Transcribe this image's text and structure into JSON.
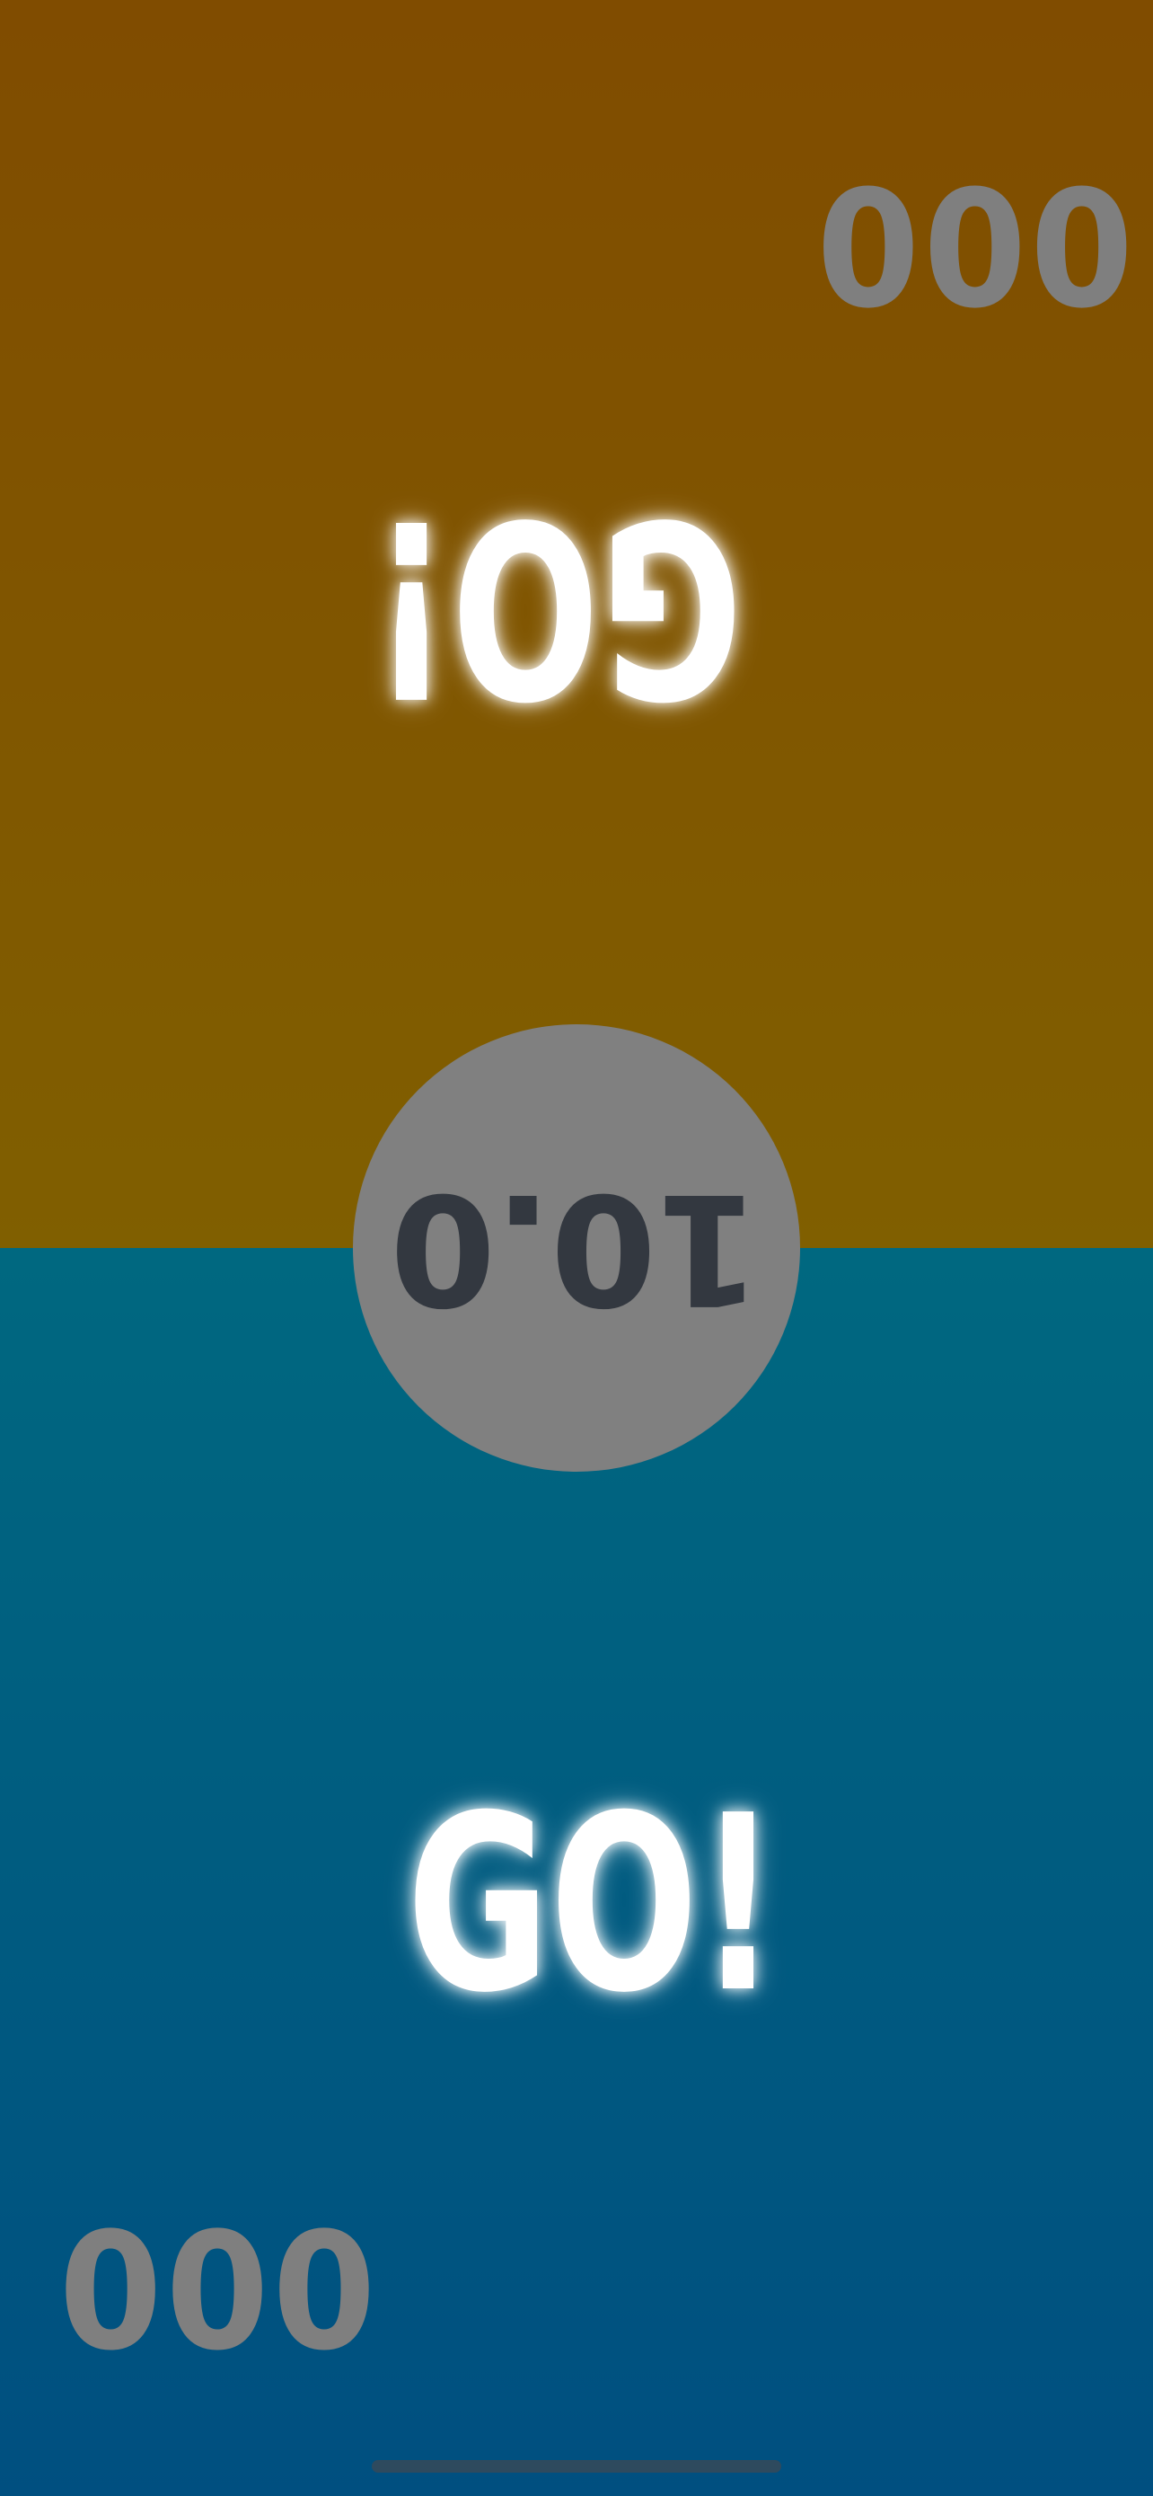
{
  "top_player": {
    "score": "000",
    "status": "GO!",
    "color": "#804c00"
  },
  "bottom_player": {
    "score": "000",
    "status": "GO!",
    "color": "#006880"
  },
  "timer": {
    "value": "10.0",
    "circle_color": "#808080",
    "text_color": "#333840"
  }
}
